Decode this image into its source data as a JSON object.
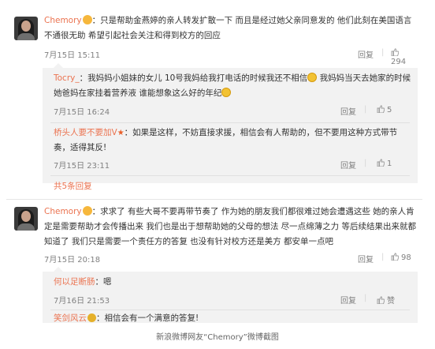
{
  "comments": [
    {
      "user": "Chemory",
      "text": "：只是帮助金燕婷的亲人转发扩散一下 而且是经过她父亲同意发的 他们此刻在美国语言不通很无助 希望引起社会关注和得到校方的回应",
      "time": "7月15日 15:11",
      "reply": "回复",
      "likes": "294",
      "replies": [
        {
          "user": "Tocry_",
          "text": "：我妈妈小姐妹的女儿 10号我妈给我打电话的时候我还不相信",
          "text2": " 我妈妈当天去她家的时候 她爸妈在家挂着营养液 谁能想象这么好的年纪",
          "time": "7月15日 16:24",
          "reply": "回复",
          "likes": "5"
        },
        {
          "user": "桥头人要不要加V",
          "text": "：如果是这样，不妨直接求援，相信会有人帮助的，但不要用这种方式带节奏，适得其反!",
          "time": "7月15日 23:11",
          "reply": "回复",
          "likes": "1"
        }
      ],
      "more": "共5条回复"
    },
    {
      "user": "Chemory",
      "text": "：求求了 有些大哥不要再带节奏了 作为她的朋友我们都很难过她会遭遇这些 她的亲人肯定是需要帮助才会传播出来 我们也是出于想帮助她的父母的想法 尽一点绵薄之力 等后续结果出来就都知道了 我们只是需要一个责任方的答复 也没有针对校方还是美方 都安单一点吧",
      "time": "7月15日 20:18",
      "reply": "回复",
      "likes": "98",
      "replies": [
        {
          "user": "何以足断肠",
          "text": "：嗯",
          "time": "7月16日 21:53",
          "reply": "回复",
          "likes": "赞"
        },
        {
          "user": "笑剑风云",
          "text": "：相信会有一个满意的答复!",
          "time": "",
          "reply": "",
          "likes": ""
        }
      ]
    }
  ],
  "caption": "新浪微博网友“Chemory”微博截图",
  "colors": {
    "username": "#eb7350",
    "meta": "#808080",
    "subbox_bg": "#f2f2f2"
  },
  "icons": [
    "thumbs-up-icon",
    "vip-badge-icon",
    "crying-emoji-icon"
  ]
}
